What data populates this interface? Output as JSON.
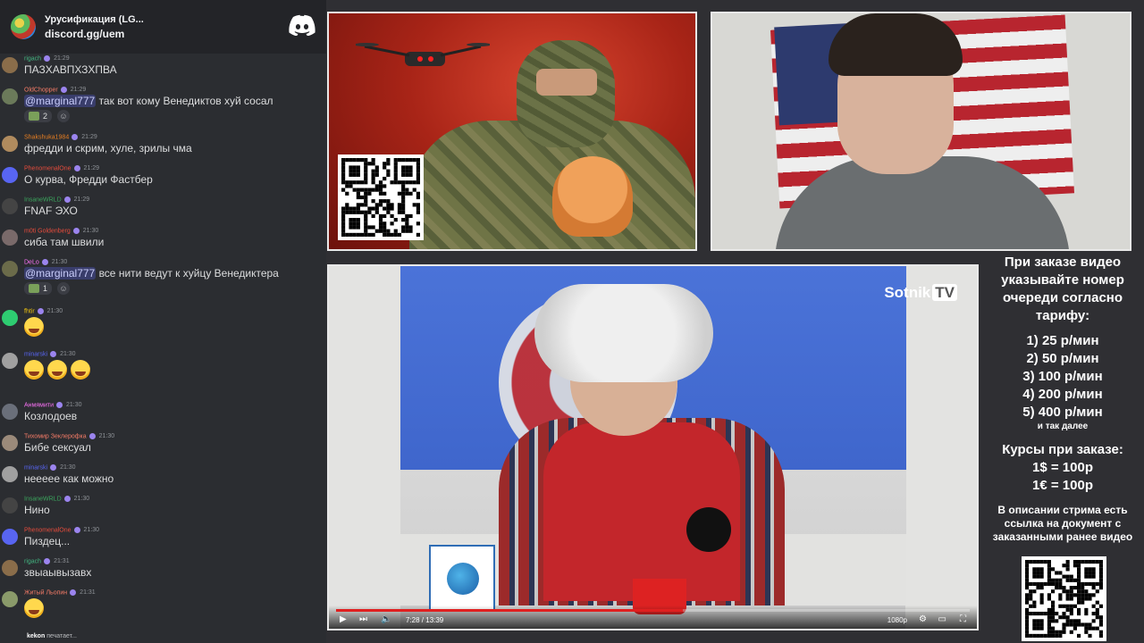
{
  "chat": {
    "server_name": "Урусификация (LG...",
    "server_invite": "discord.gg/uem",
    "typing": {
      "user": "kekon",
      "text": "печатает..."
    },
    "messages": [
      {
        "user": "rigach",
        "color": "#43b581",
        "time": "21:29",
        "text": "ПАЗХАВПХЗХПВА",
        "avatar_color": "#8a6d4a"
      },
      {
        "user": "OldChopper",
        "color": "#f47b67",
        "time": "21:29",
        "mention": "@marginal777",
        "text": " так вот кому Венедиктов хуй сосал",
        "reaction_count": "2",
        "avatar_color": "#6b7a5a"
      },
      {
        "user": "Shakshuka1984",
        "color": "#e67e22",
        "time": "21:29",
        "text": "фредди и скрим,  хуле,  зрилы чма",
        "avatar_color": "#b08b5e"
      },
      {
        "user": "PhenomenalOne",
        "color": "#e74c3c",
        "time": "21:29",
        "text": "О курва, Фредди Фастбер",
        "avatar_color": "#5865f2"
      },
      {
        "user": "InsaneWRLD",
        "color": "#3ba55d",
        "time": "21:29",
        "text": "FNAF ЭХО",
        "avatar_color": "#444"
      },
      {
        "user": "m0ti Goldenberg",
        "color": "#e74c3c",
        "time": "21:30",
        "text": "сиба там швили",
        "avatar_color": "#7a6a6a"
      },
      {
        "user": "DeLo",
        "color": "#ff73fa",
        "time": "21:30",
        "mention": "@marginal777",
        "text": " все нити ведут к хуйцу Венедиктера",
        "reaction_count": "1",
        "avatar_color": "#6b6b4a"
      },
      {
        "user": "fhtir",
        "color": "#f1c40f",
        "time": "21:30",
        "text": "",
        "emoji_count": 1,
        "avatar_color": "#2ecc71"
      },
      {
        "user": "minarski",
        "color": "#5865f2",
        "time": "21:30",
        "text": "",
        "emoji_count": 3,
        "avatar_color": "#a0a0a0"
      },
      {
        "user": "Анмямити",
        "color": "#ff73fa",
        "time": "21:30",
        "text": "Козлодоев",
        "avatar_color": "#6a6f7a"
      },
      {
        "user": "Тихомир Зеклерофка",
        "color": "#f47b67",
        "time": "21:30",
        "text": "Бибе сексуал",
        "avatar_color": "#9b8a7a"
      },
      {
        "user": "minarski",
        "color": "#5865f2",
        "time": "21:30",
        "text": "неееее как можно",
        "avatar_color": "#a0a0a0"
      },
      {
        "user": "InsaneWRLD",
        "color": "#3ba55d",
        "time": "21:30",
        "text": "Нино",
        "avatar_color": "#444"
      },
      {
        "user": "PhenomenalOne",
        "color": "#e74c3c",
        "time": "21:30",
        "text": "Пиздец...",
        "avatar_color": "#5865f2"
      },
      {
        "user": "rigach",
        "color": "#43b581",
        "time": "21:31",
        "text": "звыаывызавх",
        "avatar_color": "#8a6d4a"
      },
      {
        "user": "Житый Льопин",
        "color": "#f47b67",
        "time": "21:31",
        "text": "",
        "emoji_count": 1,
        "avatar_color": "#8a9a6a"
      }
    ]
  },
  "video": {
    "watermark": "Sotnik",
    "watermark_tv": "TV",
    "time": "7:28 / 13:39",
    "quality": "1080p",
    "progress": 0.547
  },
  "info": {
    "title": "При заказе видео указывайте номер очереди согласно тарифу:",
    "tariffs": [
      "1) 25 р/мин",
      "2) 50 р/мин",
      "3) 100 р/мин",
      "4) 200 р/мин",
      "5) 400 р/мин"
    ],
    "etc": "и так далее",
    "rates_title": "Курсы при заказе:",
    "rates": [
      "1$ = 100р",
      "1€ = 100р"
    ],
    "description": "В описании стрима есть ссылка на документ с заказанными ранее видео"
  }
}
